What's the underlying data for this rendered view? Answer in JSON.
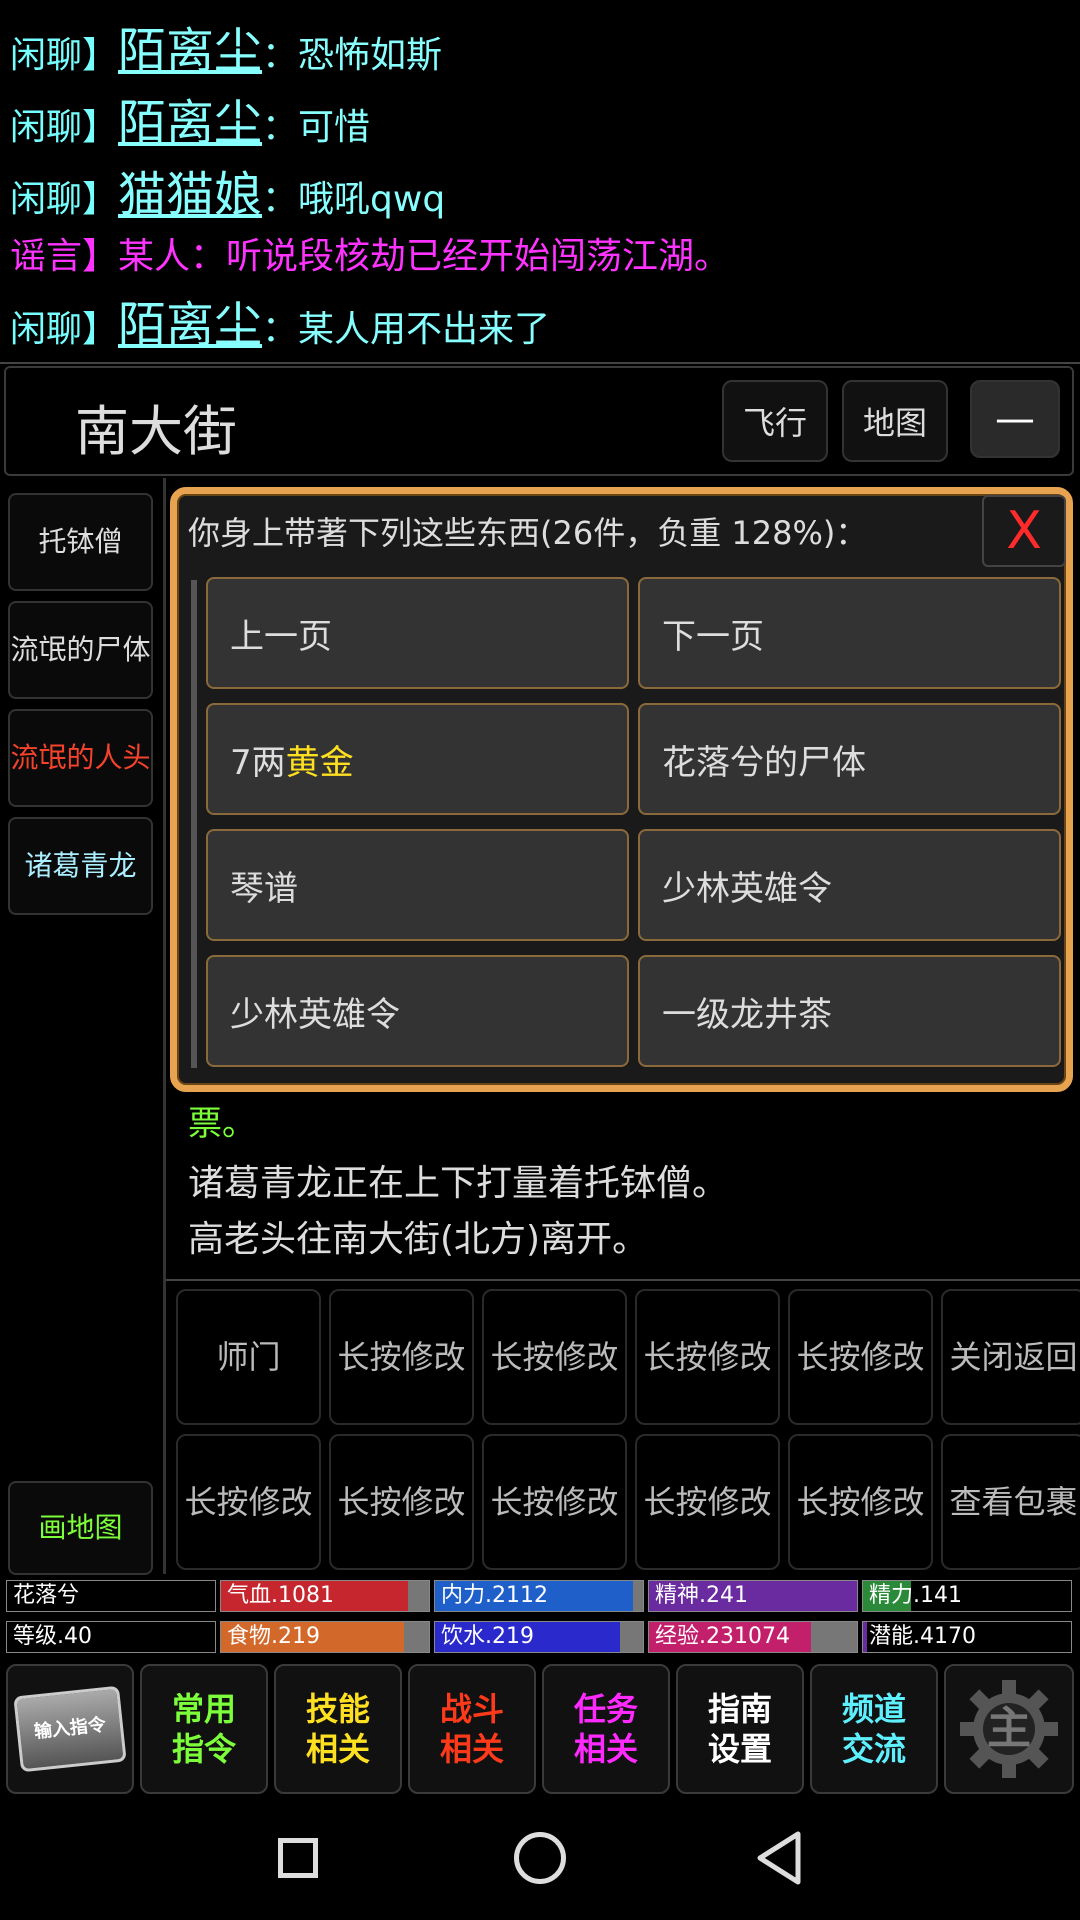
{
  "chat": [
    {
      "tag": "闲聊】",
      "name": "陌离尘",
      "msg": "：恐怖如斯"
    },
    {
      "tag": "闲聊】",
      "name": "陌离尘",
      "msg": "：可惜"
    },
    {
      "tag": "闲聊】",
      "name": "猫猫娘",
      "msg": "：哦吼qwq"
    },
    {
      "text": "谣言】某人：听说段核劫已经开始闯荡江湖。"
    },
    {
      "tag": "闲聊】",
      "name": "陌离尘",
      "msg": "：某人用不出来了"
    }
  ],
  "location": {
    "name": "南大街",
    "fly": "飞行",
    "map": "地图",
    "minimize": "—"
  },
  "npcs": [
    "托钵僧",
    "流氓的尸体",
    "流氓的人头",
    "诸葛青龙"
  ],
  "draw_map": "画地图",
  "inventory": {
    "header": "你身上带著下列这些东西(26件，负重 128%)：",
    "close": "X",
    "prev": "上一页",
    "next": "下一页",
    "items": [
      {
        "prefix": "7两",
        "highlight": "黄金"
      },
      {
        "text": "花落兮的尸体"
      },
      {
        "text": "琴谱"
      },
      {
        "text": "少林英雄令"
      },
      {
        "text": "少林英雄令"
      },
      {
        "text": "一级龙井茶"
      }
    ]
  },
  "log": [
    "票。",
    "诸葛青龙正在上下打量着托钵僧。",
    "高老头往南大街(北方)离开。"
  ],
  "actions": [
    "师门",
    "长按修改",
    "长按修改",
    "长按修改",
    "长按修改",
    "关闭返回",
    "长按修改",
    "长按修改",
    "长按修改",
    "长按修改",
    "长按修改",
    "查看包裹"
  ],
  "stats": {
    "name": "花落兮",
    "level": "等级.40",
    "hp": {
      "label": "气血.1081",
      "fill": 0.9,
      "color": "#c6262e"
    },
    "neili": {
      "label": "内力.2112",
      "fill": 0.95,
      "color": "#1f5fc9"
    },
    "jingshen": {
      "label": "精神.241",
      "fill": 1.0,
      "color": "#6a2aa0"
    },
    "jingli": {
      "label": "精力.141",
      "fill": 0.23,
      "color": "#2a8a3a"
    },
    "food": {
      "label": "食物.219",
      "fill": 0.88,
      "color": "#d2692a"
    },
    "water": {
      "label": "饮水.219",
      "fill": 0.89,
      "color": "#2a2acc"
    },
    "exp": {
      "label": "经验.231074",
      "fill": 0.78,
      "color": "#c2206a"
    },
    "potential": {
      "label": "潜能.4170",
      "fill": 0.02,
      "color": "#6a2aa0"
    }
  },
  "tabs": [
    {
      "label": "输入指令"
    },
    {
      "l1": "常用",
      "l2": "指令",
      "color": "#7cff3a"
    },
    {
      "l1": "技能",
      "l2": "相关",
      "color": "#ffe020"
    },
    {
      "l1": "战斗",
      "l2": "相关",
      "color": "#ff3a1a"
    },
    {
      "l1": "任务",
      "l2": "相关",
      "color": "#ff2aff"
    },
    {
      "l1": "指南",
      "l2": "设置",
      "color": "#ffffff"
    },
    {
      "l1": "频道",
      "l2": "交流",
      "color": "#5ff0ff"
    }
  ],
  "gear_label": "主"
}
